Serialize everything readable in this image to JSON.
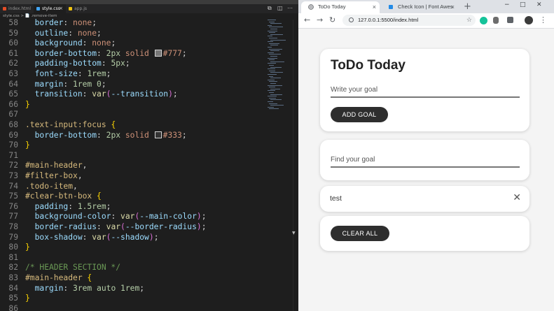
{
  "editor": {
    "tabs": [
      {
        "label": "index.html",
        "icon_color": "#e44d26",
        "active": false
      },
      {
        "label": "style.css",
        "icon_color": "#42a5f5",
        "active": true
      },
      {
        "label": "app.js",
        "icon_color": "#f1c40f",
        "active": false
      }
    ],
    "breadcrumb": "style.css > 📄 .remove-item",
    "lines": [
      {
        "n": "58",
        "tokens": [
          [
            "prop",
            "  border"
          ],
          [
            "punc",
            ": "
          ],
          [
            "val",
            "none"
          ],
          [
            "punc",
            ";"
          ]
        ]
      },
      {
        "n": "59",
        "tokens": [
          [
            "prop",
            "  outline"
          ],
          [
            "punc",
            ": "
          ],
          [
            "val",
            "none"
          ],
          [
            "punc",
            ";"
          ]
        ]
      },
      {
        "n": "60",
        "tokens": [
          [
            "prop",
            "  background"
          ],
          [
            "punc",
            ": "
          ],
          [
            "val",
            "none"
          ],
          [
            "punc",
            ";"
          ]
        ]
      },
      {
        "n": "61",
        "tokens": [
          [
            "prop",
            "  border-bottom"
          ],
          [
            "punc",
            ": "
          ],
          [
            "num",
            "2px"
          ],
          [
            "val",
            " solid "
          ],
          [
            "swatch",
            "#777777"
          ],
          [
            "val",
            "#777"
          ],
          [
            "punc",
            ";"
          ]
        ]
      },
      {
        "n": "62",
        "tokens": [
          [
            "prop",
            "  padding-bottom"
          ],
          [
            "punc",
            ": "
          ],
          [
            "num",
            "5px"
          ],
          [
            "punc",
            ";"
          ]
        ]
      },
      {
        "n": "63",
        "tokens": [
          [
            "prop",
            "  font-size"
          ],
          [
            "punc",
            ": "
          ],
          [
            "num",
            "1rem"
          ],
          [
            "punc",
            ";"
          ]
        ]
      },
      {
        "n": "64",
        "tokens": [
          [
            "prop",
            "  margin"
          ],
          [
            "punc",
            ": "
          ],
          [
            "num",
            "1rem 0"
          ],
          [
            "punc",
            ";"
          ]
        ]
      },
      {
        "n": "65",
        "tokens": [
          [
            "prop",
            "  transition"
          ],
          [
            "punc",
            ": "
          ],
          [
            "fn",
            "var"
          ],
          [
            "paren",
            "("
          ],
          [
            "cvar",
            "--transition"
          ],
          [
            "paren",
            ")"
          ],
          [
            "punc",
            ";"
          ]
        ]
      },
      {
        "n": "66",
        "tokens": [
          [
            "brace",
            "}"
          ]
        ]
      },
      {
        "n": "67",
        "tokens": []
      },
      {
        "n": "68",
        "tokens": [
          [
            "sel",
            ".text-input:focus "
          ],
          [
            "brace",
            "{"
          ]
        ]
      },
      {
        "n": "69",
        "tokens": [
          [
            "prop",
            "  border-bottom"
          ],
          [
            "punc",
            ": "
          ],
          [
            "num",
            "2px"
          ],
          [
            "val",
            " solid "
          ],
          [
            "swatch",
            "#333333"
          ],
          [
            "val",
            "#333"
          ],
          [
            "punc",
            ";"
          ]
        ]
      },
      {
        "n": "70",
        "tokens": [
          [
            "brace",
            "}"
          ]
        ]
      },
      {
        "n": "71",
        "tokens": []
      },
      {
        "n": "72",
        "tokens": [
          [
            "sel",
            "#main-header"
          ],
          [
            "punc",
            ","
          ]
        ]
      },
      {
        "n": "73",
        "tokens": [
          [
            "sel",
            "#filter-box"
          ],
          [
            "punc",
            ","
          ]
        ]
      },
      {
        "n": "74",
        "tokens": [
          [
            "sel",
            ".todo-item"
          ],
          [
            "punc",
            ","
          ]
        ]
      },
      {
        "n": "75",
        "tokens": [
          [
            "sel",
            "#clear-btn-box "
          ],
          [
            "brace",
            "{"
          ]
        ]
      },
      {
        "n": "76",
        "tokens": [
          [
            "prop",
            "  padding"
          ],
          [
            "punc",
            ": "
          ],
          [
            "num",
            "1.5rem"
          ],
          [
            "punc",
            ";"
          ]
        ]
      },
      {
        "n": "77",
        "tokens": [
          [
            "prop",
            "  background-color"
          ],
          [
            "punc",
            ": "
          ],
          [
            "fn",
            "var"
          ],
          [
            "paren",
            "("
          ],
          [
            "cvar",
            "--main-color"
          ],
          [
            "paren",
            ")"
          ],
          [
            "punc",
            ";"
          ]
        ]
      },
      {
        "n": "78",
        "tokens": [
          [
            "prop",
            "  border-radius"
          ],
          [
            "punc",
            ": "
          ],
          [
            "fn",
            "var"
          ],
          [
            "paren",
            "("
          ],
          [
            "cvar",
            "--border-radius"
          ],
          [
            "paren",
            ")"
          ],
          [
            "punc",
            ";"
          ]
        ]
      },
      {
        "n": "79",
        "tokens": [
          [
            "prop",
            "  box-shadow"
          ],
          [
            "punc",
            ": "
          ],
          [
            "fn",
            "var"
          ],
          [
            "paren",
            "("
          ],
          [
            "cvar",
            "--shadow"
          ],
          [
            "paren",
            ")"
          ],
          [
            "punc",
            ";"
          ]
        ]
      },
      {
        "n": "80",
        "tokens": [
          [
            "brace",
            "}"
          ]
        ]
      },
      {
        "n": "81",
        "tokens": []
      },
      {
        "n": "82",
        "tokens": [
          [
            "cmt",
            "/* HEADER SECTION */"
          ]
        ]
      },
      {
        "n": "83",
        "tokens": [
          [
            "sel",
            "#main-header "
          ],
          [
            "brace",
            "{"
          ]
        ]
      },
      {
        "n": "84",
        "tokens": [
          [
            "prop",
            "  margin"
          ],
          [
            "punc",
            ": "
          ],
          [
            "num",
            "3rem auto 1rem"
          ],
          [
            "punc",
            ";"
          ]
        ]
      },
      {
        "n": "85",
        "tokens": [
          [
            "brace",
            "}"
          ]
        ]
      },
      {
        "n": "86",
        "tokens": []
      }
    ]
  },
  "browser": {
    "tabs": [
      {
        "label": "ToDo Today",
        "active": true
      },
      {
        "label": "Check Icon | Font Awes",
        "active": false
      }
    ],
    "address": "127.0.0.1:5500/index.html",
    "window_controls": [
      "−",
      "□",
      "✕"
    ]
  },
  "app": {
    "title": "ToDo Today",
    "goal_placeholder": "Write your goal",
    "add_button": "ADD GOAL",
    "filter_placeholder": "Find your goal",
    "todos": [
      {
        "text": "test"
      }
    ],
    "clear_button": "CLEAR ALL"
  },
  "colors": {
    "accent_dark": "#2e2e2e",
    "card_bg": "#ffffff",
    "page_bg": "#f4f4f4"
  }
}
